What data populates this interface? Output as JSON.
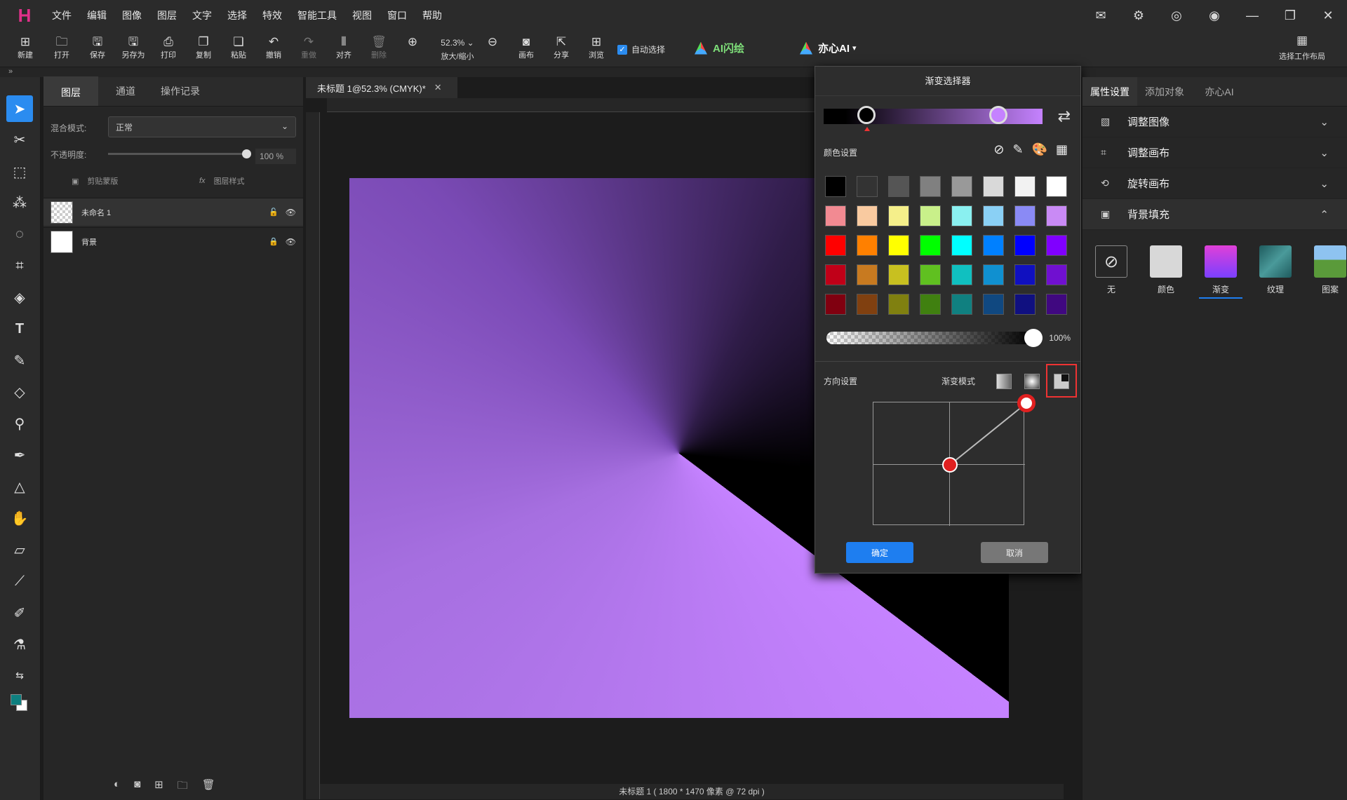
{
  "menubar": {
    "items": [
      "文件",
      "编辑",
      "图像",
      "图层",
      "文字",
      "选择",
      "特效",
      "智能工具",
      "视图",
      "窗口",
      "帮助"
    ]
  },
  "toolbar": {
    "buttons": [
      "新建",
      "打开",
      "保存",
      "另存为",
      "打印",
      "复制",
      "粘贴",
      "撤销",
      "重做",
      "对齐",
      "删除"
    ],
    "zoom_value": "52.3%",
    "zoom_label": "放大/缩小",
    "canvas": "画布",
    "share": "分享",
    "browse": "浏览",
    "auto_select": "自动选择",
    "ai_flash": "AI闪绘",
    "yixin_ai": "亦心AI",
    "workspace": "选择工作布局"
  },
  "layers_panel": {
    "tabs": [
      "图层",
      "通道",
      "操作记录"
    ],
    "blend_label": "混合模式:",
    "blend_value": "正常",
    "opacity_label": "不透明度:",
    "opacity_value": "100",
    "opacity_unit": "%",
    "clip_mask": "剪贴蒙版",
    "layer_style": "图层样式",
    "layers": [
      {
        "name": "未命名 1"
      },
      {
        "name": "背景"
      }
    ]
  },
  "document": {
    "tab_title": "未标题 1@52.3% (CMYK)*",
    "status": "未标题 1 ( 1800 * 1470 像素 @ 72 dpi )"
  },
  "gradient_dialog": {
    "title": "渐变选择器",
    "color_settings": "颜色设置",
    "swatches": [
      "#000000",
      "#333333",
      "#555555",
      "#808080",
      "#999999",
      "#d9d9d9",
      "#f2f2f2",
      "#ffffff",
      "#f28a92",
      "#f9caa0",
      "#f5ef8a",
      "#c9f08a",
      "#8af0f0",
      "#8ad0f5",
      "#8a8af5",
      "#c98af5",
      "#ff0000",
      "#ff8000",
      "#ffff00",
      "#00ff00",
      "#00ffff",
      "#0080ff",
      "#0000ff",
      "#8000ff",
      "#c00018",
      "#c87a20",
      "#c8c020",
      "#60c020",
      "#10c0c0",
      "#1090d0",
      "#1010c0",
      "#7010d0",
      "#800010",
      "#804010",
      "#808010",
      "#408010",
      "#108080",
      "#104880",
      "#101080",
      "#400880"
    ],
    "alpha_value": "100%",
    "direction_label": "方向设置",
    "mode_label": "渐变模式",
    "ok": "确定",
    "cancel": "取消",
    "gradient_start": "#000000",
    "gradient_end": "#c582ff"
  },
  "properties_panel": {
    "tabs": [
      "属性设置",
      "添加对象",
      "亦心AI"
    ],
    "sections": [
      "调整图像",
      "调整画布",
      "旋转画布",
      "背景填充"
    ],
    "fill_options": [
      "无",
      "颜色",
      "渐变",
      "纹理",
      "图案"
    ]
  }
}
